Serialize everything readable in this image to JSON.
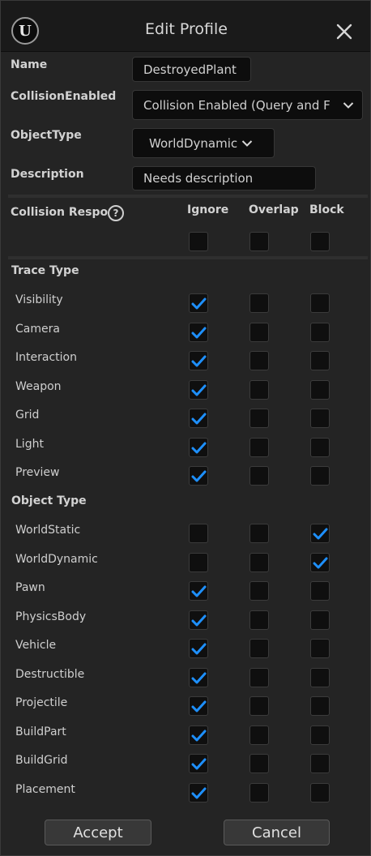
{
  "window": {
    "title": "Edit Profile",
    "logo_glyph": "U",
    "logo_icon": "unreal-engine-logo-icon",
    "close_icon": "close-icon"
  },
  "fields": {
    "name_label": "Name",
    "name_value": "DestroyedPlant",
    "collision_enabled_label": "CollisionEnabled",
    "collision_enabled_value": "Collision Enabled (Query and F",
    "object_type_label": "ObjectType",
    "object_type_value": "WorldDynamic",
    "description_label": "Description",
    "description_value": "Needs description"
  },
  "responses": {
    "header_label": "Collision Respo",
    "help_glyph": "?",
    "columns": [
      "Ignore",
      "Overlap",
      "Block"
    ],
    "master": [
      false,
      false,
      false
    ],
    "trace_section_label": "Trace Type",
    "trace_rows": [
      {
        "label": "Visibility",
        "checks": [
          true,
          false,
          false
        ]
      },
      {
        "label": "Camera",
        "checks": [
          true,
          false,
          false
        ]
      },
      {
        "label": "Interaction",
        "checks": [
          true,
          false,
          false
        ]
      },
      {
        "label": "Weapon",
        "checks": [
          true,
          false,
          false
        ]
      },
      {
        "label": "Grid",
        "checks": [
          true,
          false,
          false
        ]
      },
      {
        "label": "Light",
        "checks": [
          true,
          false,
          false
        ]
      },
      {
        "label": "Preview",
        "checks": [
          true,
          false,
          false
        ]
      }
    ],
    "object_section_label": "Object Type",
    "object_rows": [
      {
        "label": "WorldStatic",
        "checks": [
          false,
          false,
          true
        ]
      },
      {
        "label": "WorldDynamic",
        "checks": [
          false,
          false,
          true
        ]
      },
      {
        "label": "Pawn",
        "checks": [
          true,
          false,
          false
        ]
      },
      {
        "label": "PhysicsBody",
        "checks": [
          true,
          false,
          false
        ]
      },
      {
        "label": "Vehicle",
        "checks": [
          true,
          false,
          false
        ]
      },
      {
        "label": "Destructible",
        "checks": [
          true,
          false,
          false
        ]
      },
      {
        "label": "Projectile",
        "checks": [
          true,
          false,
          false
        ]
      },
      {
        "label": "BuildPart",
        "checks": [
          true,
          false,
          false
        ]
      },
      {
        "label": "BuildGrid",
        "checks": [
          true,
          false,
          false
        ]
      },
      {
        "label": "Placement",
        "checks": [
          true,
          false,
          false
        ]
      }
    ]
  },
  "buttons": {
    "accept": "Accept",
    "cancel": "Cancel"
  },
  "colors": {
    "check_accent": "#1e90ff",
    "background": "#242424",
    "field_bg": "#0d0d0d"
  }
}
